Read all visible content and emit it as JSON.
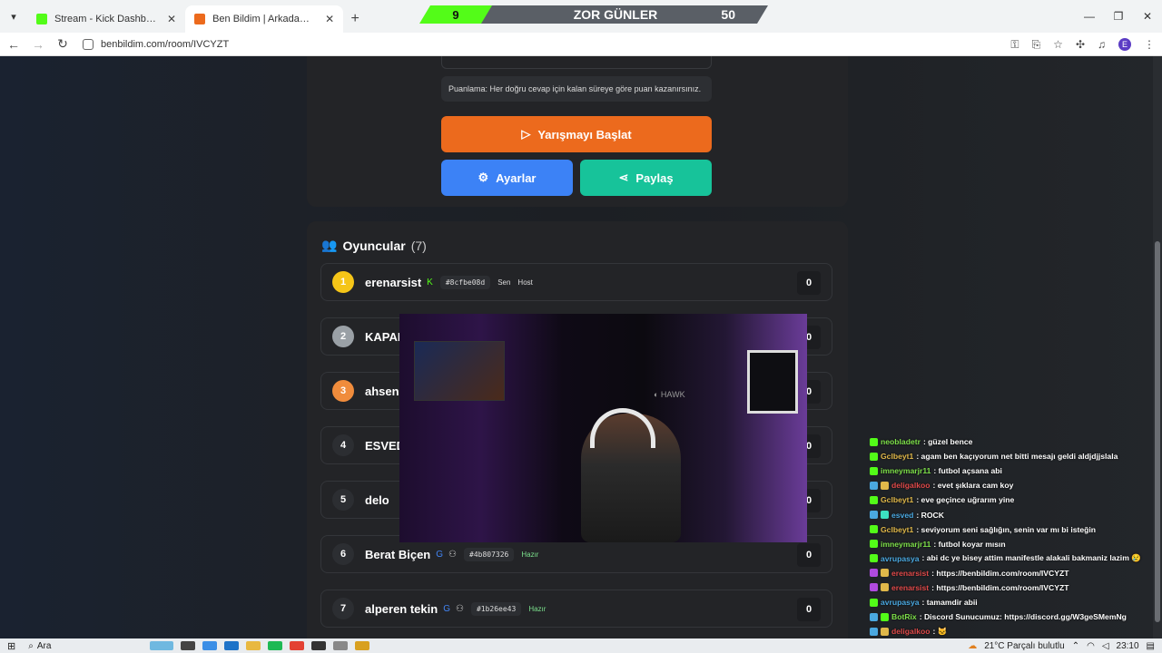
{
  "browser": {
    "tabs": [
      {
        "title": "Stream - Kick Dashboard",
        "favicon_color": "#53fc18",
        "active": false
      },
      {
        "title": "Ben Bildim | Arkadaşlarınla Onl",
        "favicon_color": "#ec6a1d",
        "active": true
      }
    ],
    "url": "benbildim.com/room/IVCYZT",
    "profile_letter": "E"
  },
  "stream_overlay": {
    "left_value": "9",
    "title": "ZOR GÜNLER",
    "right_value": "50"
  },
  "room": {
    "scoring_info": "Puanlama: Her doğru cevap için kalan süreye göre puan kazanırsınız.",
    "start_button": "Yarışmayı Başlat",
    "settings_button": "Ayarlar",
    "share_button": "Paylaş"
  },
  "players": {
    "title": "Oyuncular",
    "count": "(7)",
    "list": [
      {
        "rank": "1",
        "name": "erenarsist",
        "code": "#8cfbe08d",
        "tag1": "Sen",
        "tag2": "Host",
        "score": "0",
        "rank_color": "#f5c518"
      },
      {
        "rank": "2",
        "name": "KAPAN",
        "score": "0",
        "rank_color": "#9aa0a6"
      },
      {
        "rank": "3",
        "name": "ahsen",
        "score": "0",
        "rank_color": "#f08c3c"
      },
      {
        "rank": "4",
        "name": "ESVED",
        "score": "0",
        "rank_color": "#2c2e32"
      },
      {
        "rank": "5",
        "name": "delo",
        "score": "0",
        "rank_color": "#2c2e32"
      },
      {
        "rank": "6",
        "name": "Berat Biçen",
        "code": "#4b807326",
        "tag1": "Hazır",
        "score": "0",
        "rank_color": "#2c2e32"
      },
      {
        "rank": "7",
        "name": "alperen tekin",
        "code": "#1b26ee43",
        "tag1": "Hazır",
        "score": "0",
        "rank_color": "#2c2e32"
      }
    ]
  },
  "chat": [
    {
      "user": "neobladetr",
      "color": "#7ee04a",
      "text": ": güzel bence"
    },
    {
      "user": "Gclbeyt1",
      "color": "#e0b84a",
      "text": ": agam ben kaçıyorum net bitti mesajı geldi aldjdjjslala"
    },
    {
      "user": "imneymarjr11",
      "color": "#7ee04a",
      "text": ": futbol açsana abi"
    },
    {
      "user": "deligalkoo",
      "color": "#e04a4a",
      "text": ": evet şıklara cam koy"
    },
    {
      "user": "Gclbeyt1",
      "color": "#e0b84a",
      "text": ": eve geçince uğrarım yine"
    },
    {
      "user": "esved",
      "color": "#4aa8e0",
      "text": ": ROCK"
    },
    {
      "user": "Gclbeyt1",
      "color": "#e0b84a",
      "text": ": seviyorum seni sağlığın, senin var mı bi isteğin"
    },
    {
      "user": "imneymarjr11",
      "color": "#7ee04a",
      "text": ": futbol koyar mısın"
    },
    {
      "user": "avrupasya",
      "color": "#4aa8e0",
      "text": ": abi dc ye bisey attim manifestle alakali bakmaniz lazim 😢"
    },
    {
      "user": "erenarsist",
      "color": "#e04a4a",
      "text": ": https://benbildim.com/room/IVCYZT"
    },
    {
      "user": "erenarsist",
      "color": "#e04a4a",
      "text": ": https://benbildim.com/room/IVCYZT"
    },
    {
      "user": "avrupasya",
      "color": "#4aa8e0",
      "text": ": tamamdir abii"
    },
    {
      "user": "BotRix",
      "color": "#7ee04a",
      "text": ": Discord Sunucumuz: https://discord.gg/W3geSMemNg"
    },
    {
      "user": "deligalkoo",
      "color": "#e04a4a",
      "text": ": 🐱"
    }
  ],
  "taskbar": {
    "search_label": "Ara",
    "weather": "21°C  Parçalı bulutlu",
    "time": "23:10"
  }
}
